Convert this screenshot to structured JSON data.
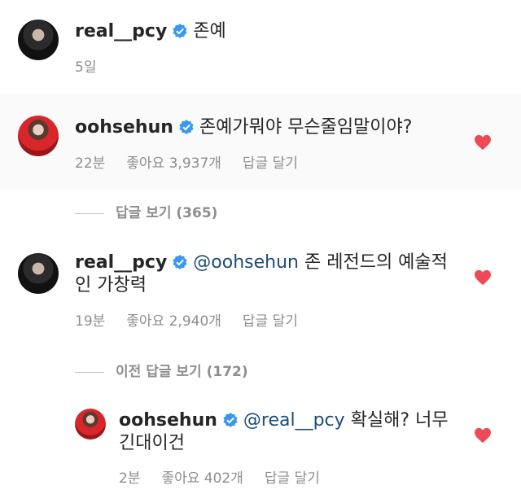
{
  "post": {
    "username": "real__pcy",
    "text": "존예",
    "time": "5일"
  },
  "comments": [
    {
      "username": "oohsehun",
      "text": "존예가뭐야 무슨줄임말이야?",
      "time": "22분",
      "likes": "좋아요 3,937개",
      "reply": "답글 달기"
    },
    {
      "username": "real__pcy",
      "mention": "@oohsehun",
      "text": "존 레전드의 예술적",
      "text_cont": "인 가창력",
      "time": "19분",
      "likes": "좋아요 2,940개",
      "reply": "답글 달기"
    },
    {
      "username": "oohsehun",
      "mention": "@real__pcy",
      "text": "확실해? 너무",
      "text_cont": "긴대이건",
      "time": "2분",
      "likes": "좋아요 402개",
      "reply": "답글 달기"
    }
  ],
  "view_replies": "답글 보기 (365)",
  "prev_replies": "이전 답글 보기 (172)",
  "colors": {
    "verified": "#3897f0",
    "heart": "#ed4956",
    "mention": "#1c4c7a"
  }
}
